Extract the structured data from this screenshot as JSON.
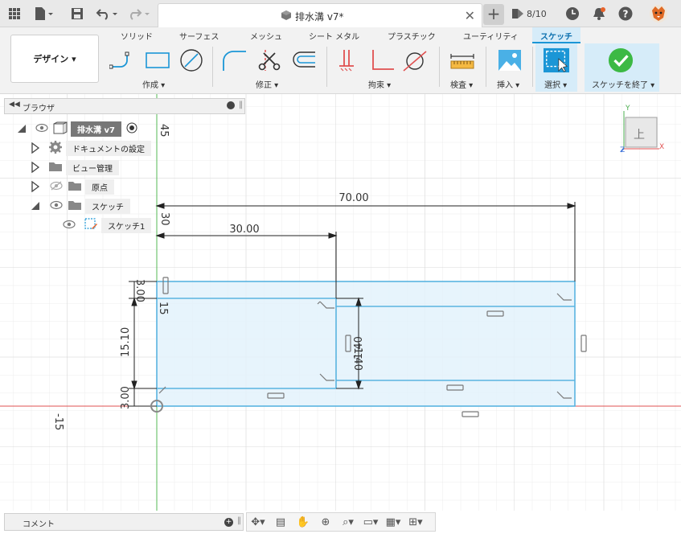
{
  "document": {
    "title": "排水溝 v7*",
    "jobs": "8/10"
  },
  "workspace": {
    "label": "デザイン ▾"
  },
  "ribbon": {
    "tabs": [
      "ソリッド",
      "サーフェス",
      "メッシュ",
      "シート メタル",
      "プラスチック",
      "ユーティリティ",
      "スケッチ"
    ],
    "active_tab": "スケッチ",
    "groups": [
      "作成 ▾",
      "修正 ▾",
      "拘束 ▾",
      "検査 ▾",
      "挿入 ▾",
      "選択 ▾",
      "スケッチを終了 ▾"
    ]
  },
  "browser": {
    "title": "ブラウザ",
    "items": [
      {
        "label": "排水溝 v7"
      },
      {
        "label": "ドキュメントの設定"
      },
      {
        "label": "ビュー管理"
      },
      {
        "label": "原点"
      },
      {
        "label": "スケッチ"
      },
      {
        "label": "スケッチ1"
      }
    ]
  },
  "viewcube": {
    "face": "上",
    "axis_x": "X",
    "axis_y": "Y",
    "axis_z": "Z"
  },
  "canvas": {
    "ruler_top": "45",
    "ruler_left": "-15",
    "dimensions": [
      "70.00",
      "30.00",
      "30",
      "3.00",
      "15",
      "15.10",
      "3.00",
      "1.40",
      "1.40"
    ]
  },
  "comment": {
    "label": "コメント"
  },
  "colors": {
    "accent": "#1b96d6",
    "sketch_line": "#5ab4e0",
    "sketch_fill": "#e3f2fb",
    "axis_red": "#e05050",
    "axis_green": "#4caf50"
  }
}
